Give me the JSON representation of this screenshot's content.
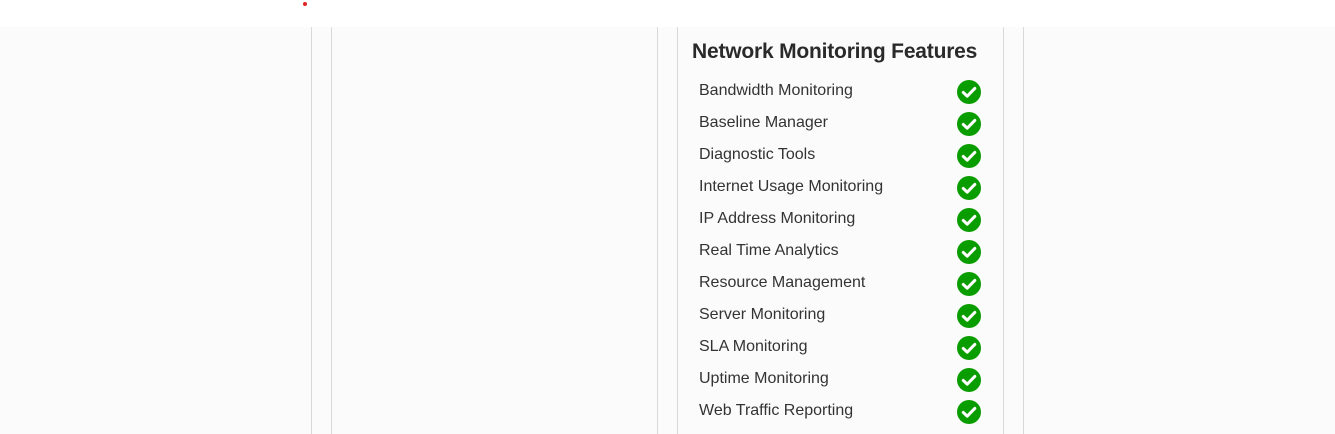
{
  "colors": {
    "check_green": "#0a9d00",
    "title_text": "#2a2a2a",
    "body_text": "#333333",
    "divider": "#d9d9d9",
    "accent_dot": "#e02424"
  },
  "panel": {
    "title": "Network Monitoring Features",
    "features": [
      {
        "label": "Bandwidth Monitoring",
        "icon": "check-circle-icon",
        "supported": true
      },
      {
        "label": "Baseline Manager",
        "icon": "check-circle-icon",
        "supported": true
      },
      {
        "label": "Diagnostic Tools",
        "icon": "check-circle-icon",
        "supported": true
      },
      {
        "label": "Internet Usage Monitoring",
        "icon": "check-circle-icon",
        "supported": true
      },
      {
        "label": "IP Address Monitoring",
        "icon": "check-circle-icon",
        "supported": true
      },
      {
        "label": "Real Time Analytics",
        "icon": "check-circle-icon",
        "supported": true
      },
      {
        "label": "Resource Management",
        "icon": "check-circle-icon",
        "supported": true
      },
      {
        "label": "Server Monitoring",
        "icon": "check-circle-icon",
        "supported": true
      },
      {
        "label": "SLA Monitoring",
        "icon": "check-circle-icon",
        "supported": true
      },
      {
        "label": "Uptime Monitoring",
        "icon": "check-circle-icon",
        "supported": true
      },
      {
        "label": "Web Traffic Reporting",
        "icon": "check-circle-icon",
        "supported": true
      }
    ]
  }
}
